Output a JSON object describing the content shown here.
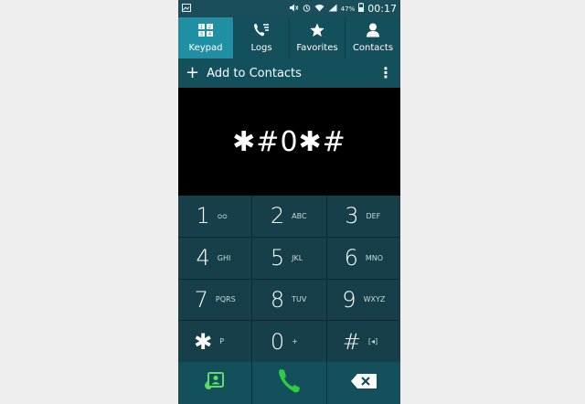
{
  "status_bar": {
    "icons": [
      "gallery-icon",
      "mute-icon",
      "alarm-icon",
      "wifi-icon",
      "signal-icon",
      "battery-icon"
    ],
    "battery_percent": "47%",
    "time": "00:17"
  },
  "tabs": [
    {
      "label": "Keypad",
      "icon": "keypad-icon",
      "active": true
    },
    {
      "label": "Logs",
      "icon": "call-log-icon",
      "active": false
    },
    {
      "label": "Favorites",
      "icon": "star-icon",
      "active": false
    },
    {
      "label": "Contacts",
      "icon": "person-icon",
      "active": false
    }
  ],
  "action_bar": {
    "add_label": "Add to Contacts"
  },
  "dial_display": "✱#0✱#",
  "keypad": {
    "keys": [
      {
        "digit": "1",
        "letters": "ᴑᴑ"
      },
      {
        "digit": "2",
        "letters": "ABC"
      },
      {
        "digit": "3",
        "letters": "DEF"
      },
      {
        "digit": "4",
        "letters": "GHI"
      },
      {
        "digit": "5",
        "letters": "JKL"
      },
      {
        "digit": "6",
        "letters": "MNO"
      },
      {
        "digit": "7",
        "letters": "PQRS"
      },
      {
        "digit": "8",
        "letters": "TUV"
      },
      {
        "digit": "9",
        "letters": "WXYZ"
      },
      {
        "digit": "✱",
        "letters": "P"
      },
      {
        "digit": "0",
        "letters": "+"
      },
      {
        "digit": "#",
        "letters": "[◂]"
      }
    ]
  },
  "bottom_bar": {
    "icons": [
      "contact-card-icon",
      "call-icon",
      "backspace-icon"
    ]
  },
  "colors": {
    "accent": "#1f8fa3",
    "keypad_bg": "#163f49",
    "call_green": "#2ecc40"
  }
}
